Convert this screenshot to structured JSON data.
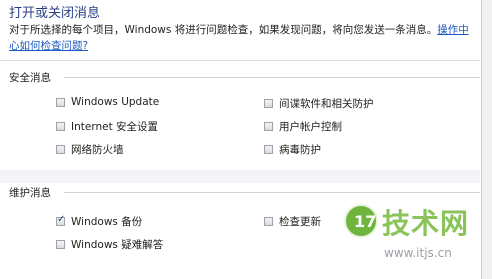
{
  "heading": "打开或关闭消息",
  "description": "对于所选择的每个项目，Windows 将进行问题检查，如果发现问题，将向您发送一条消息。",
  "description_link": "操作中心如何检查问题?",
  "security": {
    "title": "安全消息",
    "left": [
      {
        "label": "Windows Update",
        "checked": false
      },
      {
        "label": "Internet 安全设置",
        "checked": false
      },
      {
        "label": "网络防火墙",
        "checked": false
      }
    ],
    "right": [
      {
        "label": "间谍软件和相关防护",
        "checked": false
      },
      {
        "label": "用户帐户控制",
        "checked": false
      },
      {
        "label": "病毒防护",
        "checked": false
      }
    ]
  },
  "maintenance": {
    "title": "维护消息",
    "left": [
      {
        "label": "Windows 备份",
        "checked": true
      },
      {
        "label": "Windows 疑难解答",
        "checked": false
      }
    ],
    "right": [
      {
        "label": "检查更新",
        "checked": false
      }
    ]
  },
  "watermark": {
    "logo_char": "17",
    "text": "技术网",
    "url": "www.itjs.cn"
  },
  "colors": {
    "heading": "#2b3e84",
    "link": "#1f5bbf",
    "watermark_green": "#6fb43f"
  }
}
